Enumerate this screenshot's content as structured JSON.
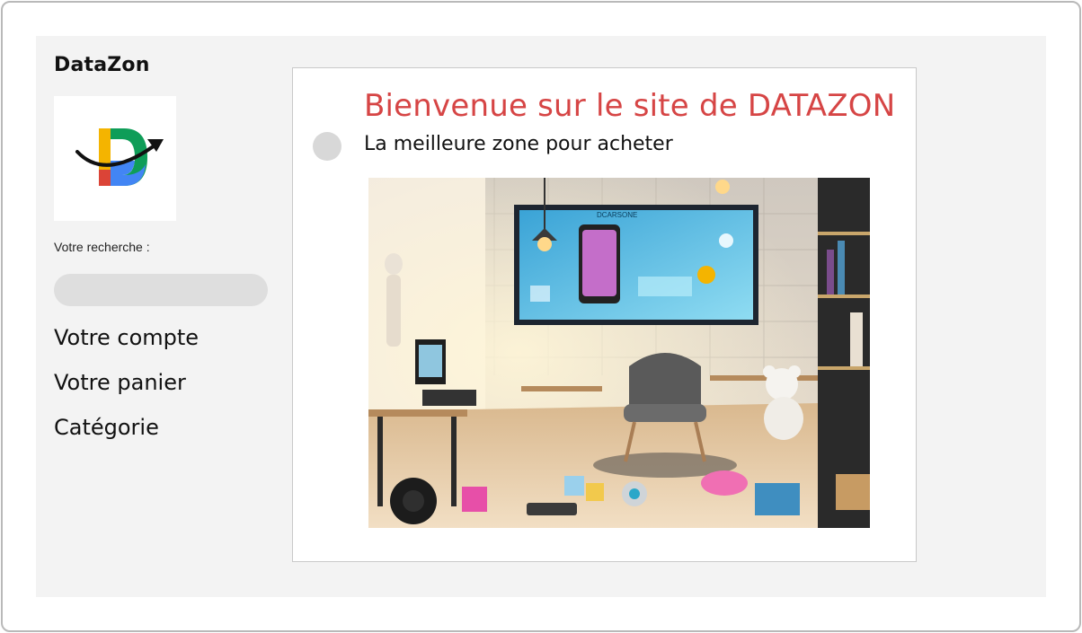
{
  "sidebar": {
    "brand": "DataZon",
    "logo": {
      "icon": "datazon-logo-icon",
      "letter": "D",
      "colors": [
        "#f4b400",
        "#db4437",
        "#0f9d58",
        "#4285f4"
      ]
    },
    "search": {
      "label": "Votre recherche :",
      "value": "",
      "placeholder": ""
    },
    "nav": {
      "account": "Votre compte",
      "cart": "Votre panier",
      "category": "Catégorie"
    }
  },
  "main": {
    "title": "Bienvenue sur le site de DATAZON",
    "subtitle": "La meilleure zone pour acheter",
    "hero_image": {
      "icon": "store-showroom-image",
      "screen_text": "DCARSONE"
    }
  },
  "colors": {
    "title": "#d64545",
    "panel_bg": "#f3f3f3",
    "input_bg": "#dedede"
  }
}
